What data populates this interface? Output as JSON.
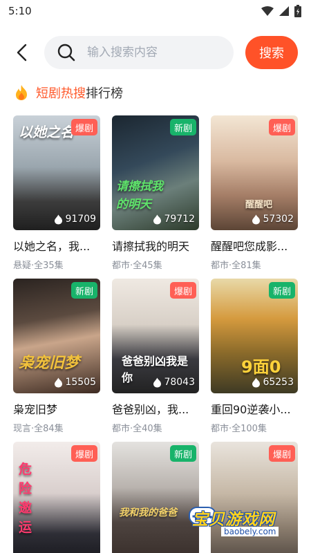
{
  "status": {
    "time": "5:10"
  },
  "search": {
    "placeholder": "输入搜索内容",
    "button": "搜索"
  },
  "rank": {
    "title_hot": "短剧热搜",
    "title_rest": "排行榜"
  },
  "cards": [
    {
      "poster_text": "以她之名",
      "badge": "爆剧",
      "views": "91709",
      "name": "以她之名，我...",
      "meta": "悬疑·全35集"
    },
    {
      "poster_text": "请擦拭我的明天",
      "badge": "新剧",
      "views": "79712",
      "name": "请擦拭我的明天",
      "meta": "都市·全45集"
    },
    {
      "poster_text": "醒醒吧",
      "badge": "爆剧",
      "views": "57302",
      "name": "醒醒吧您成影...",
      "meta": "都市·全81集"
    },
    {
      "poster_text": "枭宠旧梦",
      "badge": "新剧",
      "views": "15505",
      "name": "枭宠旧梦",
      "meta": "现言·全84集"
    },
    {
      "poster_text": "爸爸别凶我是你",
      "badge": "爆剧",
      "views": "78043",
      "name": "爸爸别凶，我...",
      "meta": "都市·全40集"
    },
    {
      "poster_text": "9面0",
      "badge": "新剧",
      "views": "65253",
      "name": "重回90逆袭小...",
      "meta": "都市·全100集"
    },
    {
      "poster_text": "危险邀运",
      "badge": "爆剧",
      "views": "",
      "name": "",
      "meta": ""
    },
    {
      "poster_text": "我和我的爸爸",
      "badge": "新剧",
      "views": "",
      "name": "",
      "meta": ""
    },
    {
      "poster_text": "",
      "badge": "爆剧",
      "views": "",
      "name": "",
      "meta": ""
    }
  ],
  "watermark": {
    "text": "宝贝游戏网",
    "domain": "baobely.com"
  },
  "colors": {
    "accent": "#ff5228",
    "badge_hot": "#ff5f55",
    "badge_new": "#18b36a"
  }
}
